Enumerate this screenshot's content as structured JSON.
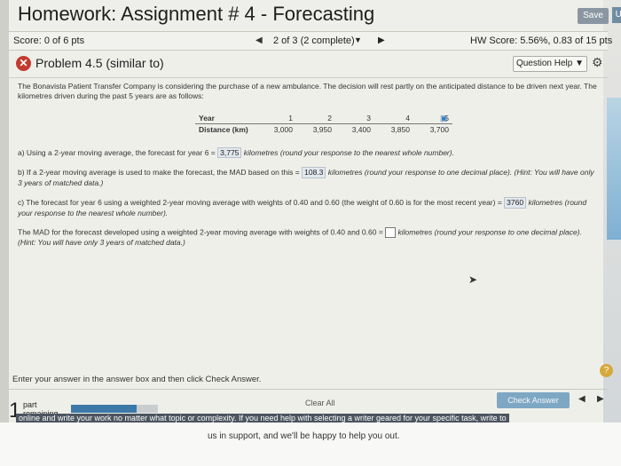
{
  "window": {
    "title": "Homework: Assignment # 4 - Forecasting",
    "save_label": "Save",
    "up_label": "Up"
  },
  "score_bar": {
    "score": "Score: 0 of 6 pts",
    "nav_status": "2 of 3 (2 complete)",
    "hw_score": "HW Score: 5.56%, 0.83 of 15 pts"
  },
  "problem": {
    "title": "Problem 4.5 (similar to)",
    "help_label": "Question Help",
    "intro": "The Bonavista Patient Transfer Company is considering the purchase of a new ambulance. The decision will rest partly on the anticipated distance to be driven next year. The kilometres driven during the past 5 years are as follows:"
  },
  "table": {
    "row1_label": "Year",
    "row2_label": "Distance (km)",
    "years": [
      "1",
      "2",
      "3",
      "4",
      "5"
    ],
    "distances": [
      "3,000",
      "3,950",
      "3,400",
      "3,850",
      "3,700"
    ]
  },
  "questions": {
    "a_pre": "a) Using a 2-year moving average, the forecast for year 6 = ",
    "a_answer": "3,775",
    "a_post": " kilometres (round your response to the nearest whole number).",
    "b_pre": "b) If a 2-year moving average is used to make the forecast, the MAD based on this = ",
    "b_answer": "108.3",
    "b_post": " kilometres (round your response to one decimal place). (Hint: You will have only 3 years of matched data.)",
    "c_pre": "c) The forecast for year 6 using a weighted 2-year moving average with weights of 0.40 and 0.60 (the weight of 0.60 is for the most recent year) = ",
    "c_answer": "3760",
    "c_post": " kilometres (round your response to the nearest whole number).",
    "d_pre": "The MAD for the forecast developed using a weighted 2-year moving average with weights of 0.40 and 0.60 = ",
    "d_post": " kilometres (round your response to one decimal place). (Hint: You will have only 3 years of matched data.)"
  },
  "footer": {
    "instruction": "Enter your answer in the answer box and then click Check Answer.",
    "part_number": "1",
    "part_label_1": "part",
    "part_label_2": "remaining",
    "progress": 0.75,
    "clear_label": "Clear All",
    "check_label": "Check Answer",
    "overlay_1": "online and write your work no matter what topic or complexity. If you need help with selecting a writer geared for your specific task, write to",
    "overlay_2": "us in support, and we'll be happy to help you out."
  },
  "colors": {
    "error_icon": "#c23b2e",
    "check_button": "#7ea7c4",
    "progress_fill": "#3c78a8"
  }
}
